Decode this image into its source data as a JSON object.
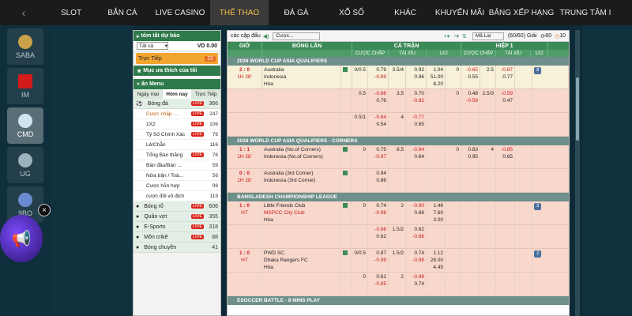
{
  "nav": {
    "back_icon": "chevron-left-icon",
    "items": [
      "SLOT",
      "BẮN CÁ",
      "LIVE CASINO",
      "THỂ THAO",
      "ĐÁ GÀ",
      "XỔ SỐ",
      "KHÁC",
      "KHUYẾN MÃI",
      "BẢNG XẾP HẠNG",
      "TRUNG TÂM I"
    ],
    "active_index": 3
  },
  "rail": {
    "tiles": [
      {
        "label": "SABA"
      },
      {
        "label": "IM"
      },
      {
        "label": "CMD"
      },
      {
        "label": "UG"
      },
      {
        "label": "9BO"
      }
    ],
    "selected_index": 2
  },
  "left_panel": {
    "bet_summary": "tóm tắt dự báo",
    "odds_select": "Tất cả",
    "balance": "VD 0.00",
    "live_label": "Trực Tiếp",
    "live_count": "22",
    "favorites": "Mục ưa thích của tôi",
    "hide_menu": "ẩn Menu",
    "tabs": [
      "Ngày mai",
      "Hôm nay",
      "Trực Tiếp"
    ],
    "live_badge": "LIVE",
    "sports": [
      {
        "name": "Bóng đá",
        "live": true,
        "count": "366"
      }
    ],
    "football_subs": [
      {
        "name": "Cược chấp ...",
        "live": true,
        "count": "247"
      },
      {
        "name": "1X2",
        "live": true,
        "count": "106"
      },
      {
        "name": "Tỷ Số Chính Xác",
        "live": true,
        "count": "76"
      },
      {
        "name": "Lẻ/Chẵn",
        "live": false,
        "count": "116"
      },
      {
        "name": "Tổng Bàn thắng",
        "live": true,
        "count": "76"
      },
      {
        "name": "Bàn đầu/Bàn ...",
        "live": false,
        "count": "59"
      },
      {
        "name": "Nửa trận / Toà...",
        "live": false,
        "count": "56"
      },
      {
        "name": "Cược hỗn hợp",
        "live": false,
        "count": "98"
      },
      {
        "name": "cược đối vô địch",
        "live": false,
        "count": "119"
      }
    ],
    "other_sports": [
      {
        "name": "Bóng rổ",
        "live": true,
        "count": "606"
      },
      {
        "name": "Quần vợt",
        "live": true,
        "count": "355"
      },
      {
        "name": "E-Sports",
        "live": true,
        "count": "318"
      },
      {
        "name": "Môn crikê",
        "live": true,
        "count": "88"
      },
      {
        "name": "Bóng chuyền",
        "live": false,
        "count": "41"
      }
    ]
  },
  "main": {
    "header": {
      "title": "các cặp đấu",
      "sound_icon": "speaker-icon",
      "filter": "Cược...",
      "odds_type": "Mã Lai",
      "counter": "(60/60) Giải",
      "val1": "80",
      "val2": "10"
    },
    "cols_top": [
      "GIỜ",
      "BÓNG LĂN",
      "CẢ TRẬN",
      "HIỆP 1"
    ],
    "cols_sub": [
      "CƯỢC CHẤP",
      "TÀI XỈU",
      "1X2",
      "CƯỢC CHẤP",
      "TÀI XỈU",
      "1X2"
    ],
    "leagues": [
      {
        "name": "2026 WORLD CUP ASIA QUALIFIERS",
        "matches": [
          {
            "score": "2 : 0",
            "time": "1H 28'",
            "state": "live",
            "teams": [
              "Australia",
              "Indonesia",
              "Hòa"
            ],
            "ft_hdp_line": [
              "0/0.5",
              ""
            ],
            "ft_hdp_odds": [
              "0.79",
              "-0.89"
            ],
            "ft_ou_line": [
              "3.5/4",
              ""
            ],
            "ft_ou_odds": [
              "0.92",
              "0.96"
            ],
            "ft_1x2": [
              "1.04",
              "51.00",
              "8.20"
            ],
            "h1_hdp_line": [
              "0",
              ""
            ],
            "h1_hdp_odds": [
              "-0.65",
              "0.55"
            ],
            "h1_ou_line": [
              "2.5",
              ""
            ],
            "h1_ou_odds": [
              "-0.87",
              "0.77"
            ],
            "more": "8"
          },
          {
            "score": "",
            "time": "",
            "state": "pre",
            "teams": [
              "",
              "",
              ""
            ],
            "ft_hdp_line": [
              "0.5",
              ""
            ],
            "ft_hdp_odds": [
              "-0.86",
              "0.76"
            ],
            "ft_ou_line": [
              "3.5",
              ""
            ],
            "ft_ou_odds": [
              "0.70",
              "-0.82"
            ],
            "ft_1x2": [
              "",
              "",
              ""
            ],
            "h1_hdp_line": [
              "0",
              ""
            ],
            "h1_hdp_odds": [
              "0.48",
              "-0.58"
            ],
            "h1_ou_line": [
              "2.5/3",
              ""
            ],
            "h1_ou_odds": [
              "-0.59",
              "0.47"
            ],
            "more": ""
          },
          {
            "score": "",
            "time": "",
            "state": "pre",
            "teams": [
              "",
              "",
              ""
            ],
            "ft_hdp_line": [
              "0.5/1",
              ""
            ],
            "ft_hdp_odds": [
              "-0.64",
              "0.54"
            ],
            "ft_ou_line": [
              "4",
              ""
            ],
            "ft_ou_odds": [
              "-0.77",
              "0.65"
            ],
            "ft_1x2": [
              "",
              "",
              ""
            ],
            "h1_hdp_line": [
              "",
              ""
            ],
            "h1_hdp_odds": [
              "",
              ""
            ],
            "h1_ou_line": [
              "",
              ""
            ],
            "h1_ou_odds": [
              "",
              ""
            ],
            "more": ""
          }
        ]
      },
      {
        "name": "2026 WORLD CUP ASIA QUALIFIERS - CORNERS",
        "matches": [
          {
            "score": "1 : 1",
            "time": "1H 28'",
            "state": "pre",
            "teams": [
              "Australia (No.of Corners)",
              "Indonesia (No.of Corners)",
              ""
            ],
            "ft_hdp_line": [
              "0",
              ""
            ],
            "ft_hdp_odds": [
              "0.75",
              "-0.97"
            ],
            "ft_ou_line": [
              "8.5",
              ""
            ],
            "ft_ou_odds": [
              "-0.84",
              "0.64"
            ],
            "ft_1x2": [
              "",
              "",
              ""
            ],
            "h1_hdp_line": [
              "0",
              ""
            ],
            "h1_hdp_odds": [
              "0.83",
              "0.95"
            ],
            "h1_ou_line": [
              "4",
              ""
            ],
            "h1_ou_odds": [
              "-0.85",
              "0.65"
            ],
            "more": ""
          },
          {
            "score": "0 : 0",
            "time": "1H 28'",
            "state": "pre",
            "teams": [
              "Australia (3rd Corner)",
              "Indonesia (3rd Corner)",
              ""
            ],
            "ft_hdp_line": [
              "",
              ""
            ],
            "ft_hdp_odds": [
              "0.94",
              "0.86"
            ],
            "ft_ou_line": [
              "",
              ""
            ],
            "ft_ou_odds": [
              "",
              ""
            ],
            "ft_1x2": [
              "",
              "",
              ""
            ],
            "h1_hdp_line": [
              "",
              ""
            ],
            "h1_hdp_odds": [
              "",
              ""
            ],
            "h1_ou_line": [
              "",
              ""
            ],
            "h1_ou_odds": [
              "",
              ""
            ],
            "more": ""
          }
        ]
      },
      {
        "name": "BANGLADESH CHAMPIONSHIP LEAGUE",
        "matches": [
          {
            "score": "1 : 0",
            "time": "HT",
            "state": "pre",
            "teams": [
              "Little Friends Club",
              "MSPCC City Club",
              "Hòa"
            ],
            "ft_hdp_line": [
              "0",
              ""
            ],
            "ft_hdp_odds": [
              "0.74",
              "-0.98"
            ],
            "ft_ou_line": [
              "2",
              ""
            ],
            "ft_ou_odds": [
              "-0.90",
              "0.66"
            ],
            "ft_1x2": [
              "1.46",
              "7.60",
              "3.00"
            ],
            "h1_hdp_line": [
              "",
              ""
            ],
            "h1_hdp_odds": [
              "",
              ""
            ],
            "h1_ou_line": [
              "",
              ""
            ],
            "h1_ou_odds": [
              "",
              ""
            ],
            "more": "3"
          },
          {
            "score": "",
            "time": "",
            "state": "pre",
            "teams": [
              "",
              "",
              ""
            ],
            "ft_hdp_line": [
              "",
              ""
            ],
            "ft_hdp_odds": [
              "-0.86",
              "0.62"
            ],
            "ft_ou_line": [
              "1.5/2",
              ""
            ],
            "ft_ou_odds": [
              "0.62",
              "-0.86"
            ],
            "ft_1x2": [
              "",
              "",
              ""
            ],
            "h1_hdp_line": [
              "",
              ""
            ],
            "h1_hdp_odds": [
              "",
              ""
            ],
            "h1_ou_line": [
              "",
              ""
            ],
            "h1_ou_odds": [
              "",
              ""
            ],
            "more": ""
          },
          {
            "score": "1 : 0",
            "time": "HT",
            "state": "pre",
            "teams": [
              "PWD SC",
              "Dhaka Rangers FC",
              "Hòa"
            ],
            "ft_hdp_line": [
              "0/0.5",
              ""
            ],
            "ft_hdp_odds": [
              "0.87",
              "-0.99"
            ],
            "ft_ou_line": [
              "1.5/2",
              ""
            ],
            "ft_ou_odds": [
              "0.74",
              "-0.98"
            ],
            "ft_1x2": [
              "1.12",
              "28.00",
              "4.45"
            ],
            "h1_hdp_line": [
              "",
              ""
            ],
            "h1_hdp_odds": [
              "",
              ""
            ],
            "h1_ou_line": [
              "",
              ""
            ],
            "h1_ou_odds": [
              "",
              ""
            ],
            "more": "2"
          },
          {
            "score": "",
            "time": "",
            "state": "pre",
            "teams": [
              "",
              "",
              ""
            ],
            "ft_hdp_line": [
              "0",
              ""
            ],
            "ft_hdp_odds": [
              "0.61",
              "-0.85"
            ],
            "ft_ou_line": [
              "2",
              ""
            ],
            "ft_ou_odds": [
              "-0.98",
              "0.74"
            ],
            "ft_1x2": [
              "",
              "",
              ""
            ],
            "h1_hdp_line": [
              "",
              ""
            ],
            "h1_hdp_odds": [
              "",
              ""
            ],
            "h1_ou_line": [
              "",
              ""
            ],
            "h1_ou_odds": [
              "",
              ""
            ],
            "more": ""
          }
        ]
      },
      {
        "name": "ESOCCER BATTLE - 8 MINS PLAY",
        "matches": []
      }
    ]
  },
  "colors": {
    "header_green": "#3c8a58",
    "live_row": "#f6f1d8",
    "pre_row": "#f9d8cc",
    "odds_negative": "#c81818",
    "nav_active": "#f3c24a"
  }
}
